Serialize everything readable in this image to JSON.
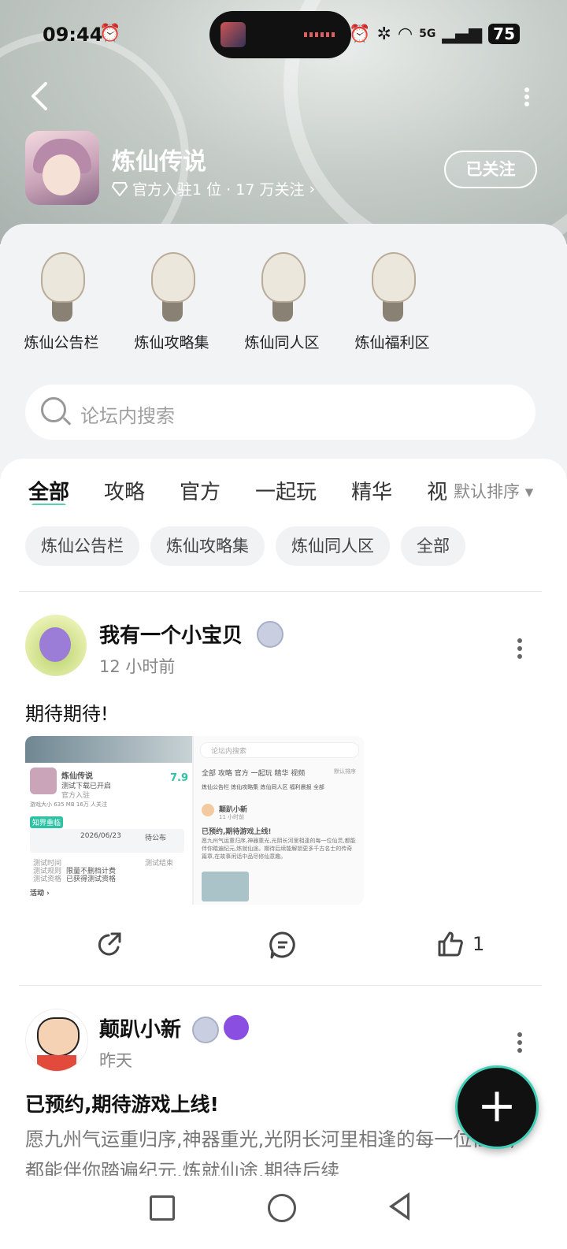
{
  "status_bar": {
    "time": "09:44",
    "battery": "75",
    "network": "5G"
  },
  "header": {
    "app_name": "炼仙传说",
    "subtitle": "官方入驻1 位 · 17 万关注",
    "subtitle_arrow": "›",
    "follow_label": "已关注",
    "back_icon": "back-arrow-icon",
    "more_icon": "more-vertical-icon"
  },
  "categories": [
    {
      "label": "炼仙公告栏"
    },
    {
      "label": "炼仙攻略集"
    },
    {
      "label": "炼仙同人区"
    },
    {
      "label": "炼仙福利区"
    }
  ],
  "search": {
    "placeholder": "论坛内搜索"
  },
  "tabs": [
    {
      "label": "全部",
      "active": true
    },
    {
      "label": "攻略"
    },
    {
      "label": "官方"
    },
    {
      "label": "一起玩"
    },
    {
      "label": "精华"
    },
    {
      "label": "视"
    }
  ],
  "sort_label": "默认排序",
  "sort_arrow": "▾",
  "chips": [
    "炼仙公告栏",
    "炼仙攻略集",
    "炼仙同人区",
    "全部"
  ],
  "posts": [
    {
      "username": "我有一个小宝贝",
      "time": "12 小时前",
      "text": "期待期待!",
      "like_count": "1",
      "screenshot1": {
        "title": "炼仙传说",
        "line1": "测试下载已开启",
        "line2": "官方入驻",
        "score": "7.9",
        "stats": "游戏大小 635 MB    16万 人关注",
        "tag": "知界重临",
        "date": "2026/06/23",
        "pending": "待公布",
        "r1a": "测试时间",
        "r1b": "测试结束",
        "r2a": "测试规则",
        "r2b": "限量不删档计费",
        "r3a": "测试资格",
        "r3b": "已获得测试资格",
        "activity": "活动 ›"
      },
      "screenshot2": {
        "search": "论坛内搜索",
        "tabs": "全部  攻略  官方  一起玩  精华  视频",
        "sort": "默认排序",
        "chips": "炼仙公告栏  炼仙攻略集  炼仙同人区  福利晨报  全部",
        "user": "颠趴小新",
        "time": "11 小时前",
        "headline": "已预约,期待游戏上线!",
        "body": "愿九州气运重归序,神器重光,光阴长河里相逢的每一位仙灵,都能伴你踏遍纪元,炼就仙途。期待后续能解锁更多千古名士的传奇篇章,在故事闲话中品尽修仙意趣。"
      }
    },
    {
      "username": "颠趴小新",
      "time": "昨天",
      "headline": "已预约,期待游戏上线!",
      "body": "愿九州气运重归序,神器重光,光阴长河里相逢的每一位仙灵,都能伴你踏遍纪元,炼就仙途,期待后续"
    }
  ],
  "fab_label": "+",
  "colors": {
    "accent": "#2ec2a5",
    "card_bg": "#f2f3f5"
  }
}
